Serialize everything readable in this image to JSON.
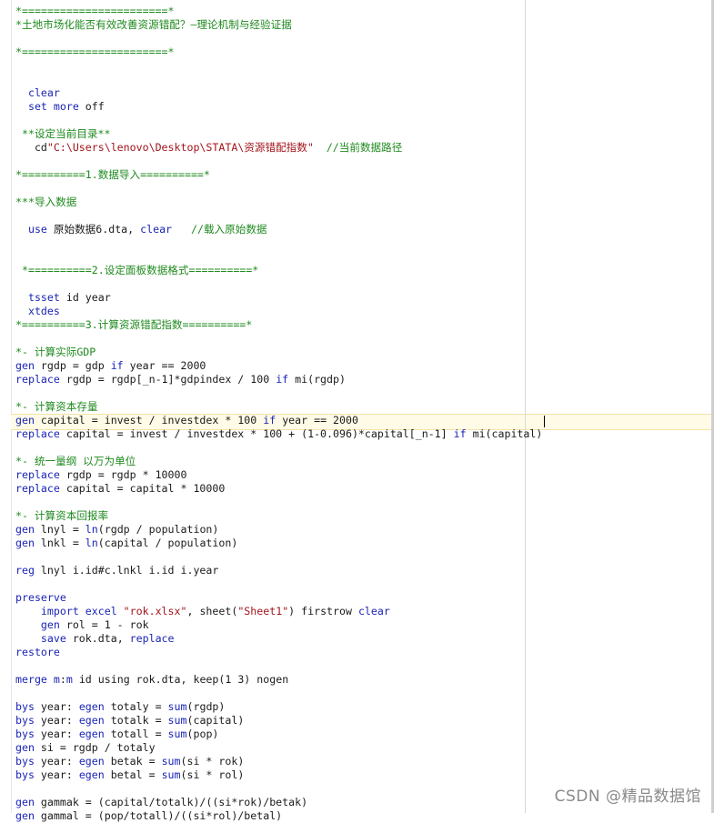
{
  "editor": {
    "current_line": 31,
    "lines": [
      {
        "tokens": [
          {
            "c": "tok-comment",
            "t": "*=======================*"
          }
        ]
      },
      {
        "tokens": [
          {
            "c": "tok-comment",
            "t": "*土地市场化能否有效改善资源错配？—理论机制与经验证据"
          }
        ]
      },
      {
        "tokens": []
      },
      {
        "tokens": [
          {
            "c": "tok-comment",
            "t": "*=======================*"
          }
        ]
      },
      {
        "tokens": []
      },
      {
        "tokens": []
      },
      {
        "tokens": [
          {
            "c": "tok-kw",
            "t": "  clear"
          }
        ]
      },
      {
        "tokens": [
          {
            "c": "tok-kw",
            "t": "  set more "
          },
          {
            "c": "tok-plain",
            "t": "off"
          }
        ]
      },
      {
        "tokens": []
      },
      {
        "tokens": [
          {
            "c": "tok-comment",
            "t": " **设定当前目录**"
          }
        ]
      },
      {
        "tokens": [
          {
            "c": "tok-plain",
            "t": "   cd"
          },
          {
            "c": "tok-str",
            "t": "\"C:\\Users\\lenovo\\Desktop\\STATA\\资源错配指数\""
          },
          {
            "c": "tok-plain",
            "t": "  "
          },
          {
            "c": "tok-comment",
            "t": "//当前数据路径"
          }
        ]
      },
      {
        "tokens": []
      },
      {
        "tokens": [
          {
            "c": "tok-comment",
            "t": "*==========1.数据导入==========*"
          }
        ]
      },
      {
        "tokens": []
      },
      {
        "tokens": [
          {
            "c": "tok-comment",
            "t": "***导入数据"
          }
        ]
      },
      {
        "tokens": []
      },
      {
        "tokens": [
          {
            "c": "tok-kw",
            "t": "  use "
          },
          {
            "c": "tok-plain",
            "t": "原始数据6.dta, "
          },
          {
            "c": "tok-kw",
            "t": "clear"
          },
          {
            "c": "tok-plain",
            "t": "   "
          },
          {
            "c": "tok-comment",
            "t": "//载入原始数据"
          }
        ]
      },
      {
        "tokens": []
      },
      {
        "tokens": []
      },
      {
        "tokens": [
          {
            "c": "tok-comment",
            "t": " *==========2.设定面板数据格式==========*"
          }
        ]
      },
      {
        "tokens": []
      },
      {
        "tokens": [
          {
            "c": "tok-kw",
            "t": "  tsset "
          },
          {
            "c": "tok-plain",
            "t": "id year"
          }
        ]
      },
      {
        "tokens": [
          {
            "c": "tok-kw",
            "t": "  xtdes"
          }
        ]
      },
      {
        "tokens": [
          {
            "c": "tok-comment",
            "t": "*==========3.计算资源错配指数==========*"
          }
        ]
      },
      {
        "tokens": []
      },
      {
        "tokens": [
          {
            "c": "tok-comment",
            "t": "*- 计算实际GDP"
          }
        ]
      },
      {
        "tokens": [
          {
            "c": "tok-kw",
            "t": "gen "
          },
          {
            "c": "tok-plain",
            "t": "rgdp = gdp "
          },
          {
            "c": "tok-kw",
            "t": "if "
          },
          {
            "c": "tok-plain",
            "t": "year == 2000"
          }
        ]
      },
      {
        "tokens": [
          {
            "c": "tok-kw",
            "t": "replace "
          },
          {
            "c": "tok-plain",
            "t": "rgdp = rgdp[_n-1]*gdpindex / 100 "
          },
          {
            "c": "tok-kw",
            "t": "if "
          },
          {
            "c": "tok-plain",
            "t": "mi(rgdp)"
          }
        ]
      },
      {
        "tokens": []
      },
      {
        "tokens": [
          {
            "c": "tok-comment",
            "t": "*- 计算资本存量"
          }
        ]
      },
      {
        "tokens": [
          {
            "c": "tok-kw",
            "t": "gen "
          },
          {
            "c": "tok-plain",
            "t": "capital = invest / investdex * 100 "
          },
          {
            "c": "tok-kw",
            "t": "if "
          },
          {
            "c": "tok-plain",
            "t": "year == 2000"
          }
        ]
      },
      {
        "tokens": [
          {
            "c": "tok-kw",
            "t": "replace "
          },
          {
            "c": "tok-plain",
            "t": "capital = invest / investdex * 100 + (1-0.096)*capital[_n-1] "
          },
          {
            "c": "tok-kw",
            "t": "if "
          },
          {
            "c": "tok-plain",
            "t": "mi(capital)"
          }
        ]
      },
      {
        "tokens": []
      },
      {
        "tokens": [
          {
            "c": "tok-comment",
            "t": "*- 统一量纲 以万为单位"
          }
        ]
      },
      {
        "tokens": [
          {
            "c": "tok-kw",
            "t": "replace "
          },
          {
            "c": "tok-plain",
            "t": "rgdp = rgdp * 10000"
          }
        ]
      },
      {
        "tokens": [
          {
            "c": "tok-kw",
            "t": "replace "
          },
          {
            "c": "tok-plain",
            "t": "capital = capital * 10000"
          }
        ]
      },
      {
        "tokens": []
      },
      {
        "tokens": [
          {
            "c": "tok-comment",
            "t": "*- 计算资本回报率"
          }
        ]
      },
      {
        "tokens": [
          {
            "c": "tok-kw",
            "t": "gen "
          },
          {
            "c": "tok-plain",
            "t": "lnyl = "
          },
          {
            "c": "tok-fn",
            "t": "ln"
          },
          {
            "c": "tok-plain",
            "t": "(rgdp / population)"
          }
        ]
      },
      {
        "tokens": [
          {
            "c": "tok-kw",
            "t": "gen "
          },
          {
            "c": "tok-plain",
            "t": "lnkl = "
          },
          {
            "c": "tok-fn",
            "t": "ln"
          },
          {
            "c": "tok-plain",
            "t": "(capital / population)"
          }
        ]
      },
      {
        "tokens": []
      },
      {
        "tokens": [
          {
            "c": "tok-kw",
            "t": "reg "
          },
          {
            "c": "tok-plain",
            "t": "lnyl i.id#c.lnkl i.id i.year"
          }
        ]
      },
      {
        "tokens": []
      },
      {
        "tokens": [
          {
            "c": "tok-kw",
            "t": "preserve"
          }
        ]
      },
      {
        "tokens": [
          {
            "c": "tok-kw",
            "t": "    import excel "
          },
          {
            "c": "tok-str",
            "t": "\"rok.xlsx\""
          },
          {
            "c": "tok-plain",
            "t": ", sheet("
          },
          {
            "c": "tok-str",
            "t": "\"Sheet1\""
          },
          {
            "c": "tok-plain",
            "t": ") firstrow "
          },
          {
            "c": "tok-kw",
            "t": "clear"
          }
        ]
      },
      {
        "tokens": [
          {
            "c": "tok-kw",
            "t": "    gen "
          },
          {
            "c": "tok-plain",
            "t": "rol = 1 - rok"
          }
        ]
      },
      {
        "tokens": [
          {
            "c": "tok-kw",
            "t": "    save "
          },
          {
            "c": "tok-plain",
            "t": "rok.dta, "
          },
          {
            "c": "tok-kw",
            "t": "replace"
          }
        ]
      },
      {
        "tokens": [
          {
            "c": "tok-kw",
            "t": "restore"
          }
        ]
      },
      {
        "tokens": []
      },
      {
        "tokens": [
          {
            "c": "tok-kw",
            "t": "merge m"
          },
          {
            "c": "tok-plain",
            "t": ":"
          },
          {
            "c": "tok-kw",
            "t": "m "
          },
          {
            "c": "tok-plain",
            "t": "id using rok.dta, keep(1 3) nogen"
          }
        ]
      },
      {
        "tokens": []
      },
      {
        "tokens": [
          {
            "c": "tok-kw",
            "t": "bys "
          },
          {
            "c": "tok-plain",
            "t": "year: "
          },
          {
            "c": "tok-kw",
            "t": "egen "
          },
          {
            "c": "tok-plain",
            "t": "totaly = "
          },
          {
            "c": "tok-fn",
            "t": "sum"
          },
          {
            "c": "tok-plain",
            "t": "(rgdp)"
          }
        ]
      },
      {
        "tokens": [
          {
            "c": "tok-kw",
            "t": "bys "
          },
          {
            "c": "tok-plain",
            "t": "year: "
          },
          {
            "c": "tok-kw",
            "t": "egen "
          },
          {
            "c": "tok-plain",
            "t": "totalk = "
          },
          {
            "c": "tok-fn",
            "t": "sum"
          },
          {
            "c": "tok-plain",
            "t": "(capital)"
          }
        ]
      },
      {
        "tokens": [
          {
            "c": "tok-kw",
            "t": "bys "
          },
          {
            "c": "tok-plain",
            "t": "year: "
          },
          {
            "c": "tok-kw",
            "t": "egen "
          },
          {
            "c": "tok-plain",
            "t": "totall = "
          },
          {
            "c": "tok-fn",
            "t": "sum"
          },
          {
            "c": "tok-plain",
            "t": "(pop)"
          }
        ]
      },
      {
        "tokens": [
          {
            "c": "tok-kw",
            "t": "gen "
          },
          {
            "c": "tok-plain",
            "t": "si = rgdp / totaly"
          }
        ]
      },
      {
        "tokens": [
          {
            "c": "tok-kw",
            "t": "bys "
          },
          {
            "c": "tok-plain",
            "t": "year: "
          },
          {
            "c": "tok-kw",
            "t": "egen "
          },
          {
            "c": "tok-plain",
            "t": "betak = "
          },
          {
            "c": "tok-fn",
            "t": "sum"
          },
          {
            "c": "tok-plain",
            "t": "(si * rok)"
          }
        ]
      },
      {
        "tokens": [
          {
            "c": "tok-kw",
            "t": "bys "
          },
          {
            "c": "tok-plain",
            "t": "year: "
          },
          {
            "c": "tok-kw",
            "t": "egen "
          },
          {
            "c": "tok-plain",
            "t": "betal = "
          },
          {
            "c": "tok-fn",
            "t": "sum"
          },
          {
            "c": "tok-plain",
            "t": "(si * rol)"
          }
        ]
      },
      {
        "tokens": []
      },
      {
        "tokens": [
          {
            "c": "tok-kw",
            "t": "gen "
          },
          {
            "c": "tok-plain",
            "t": "gammak = (capital/totalk)/((si*rok)/betak)"
          }
        ]
      },
      {
        "tokens": [
          {
            "c": "tok-kw",
            "t": "gen "
          },
          {
            "c": "tok-plain",
            "t": "gammal = (pop/totall)/((si*rol)/betal)"
          }
        ]
      }
    ]
  },
  "watermark": "CSDN @精品数据馆"
}
